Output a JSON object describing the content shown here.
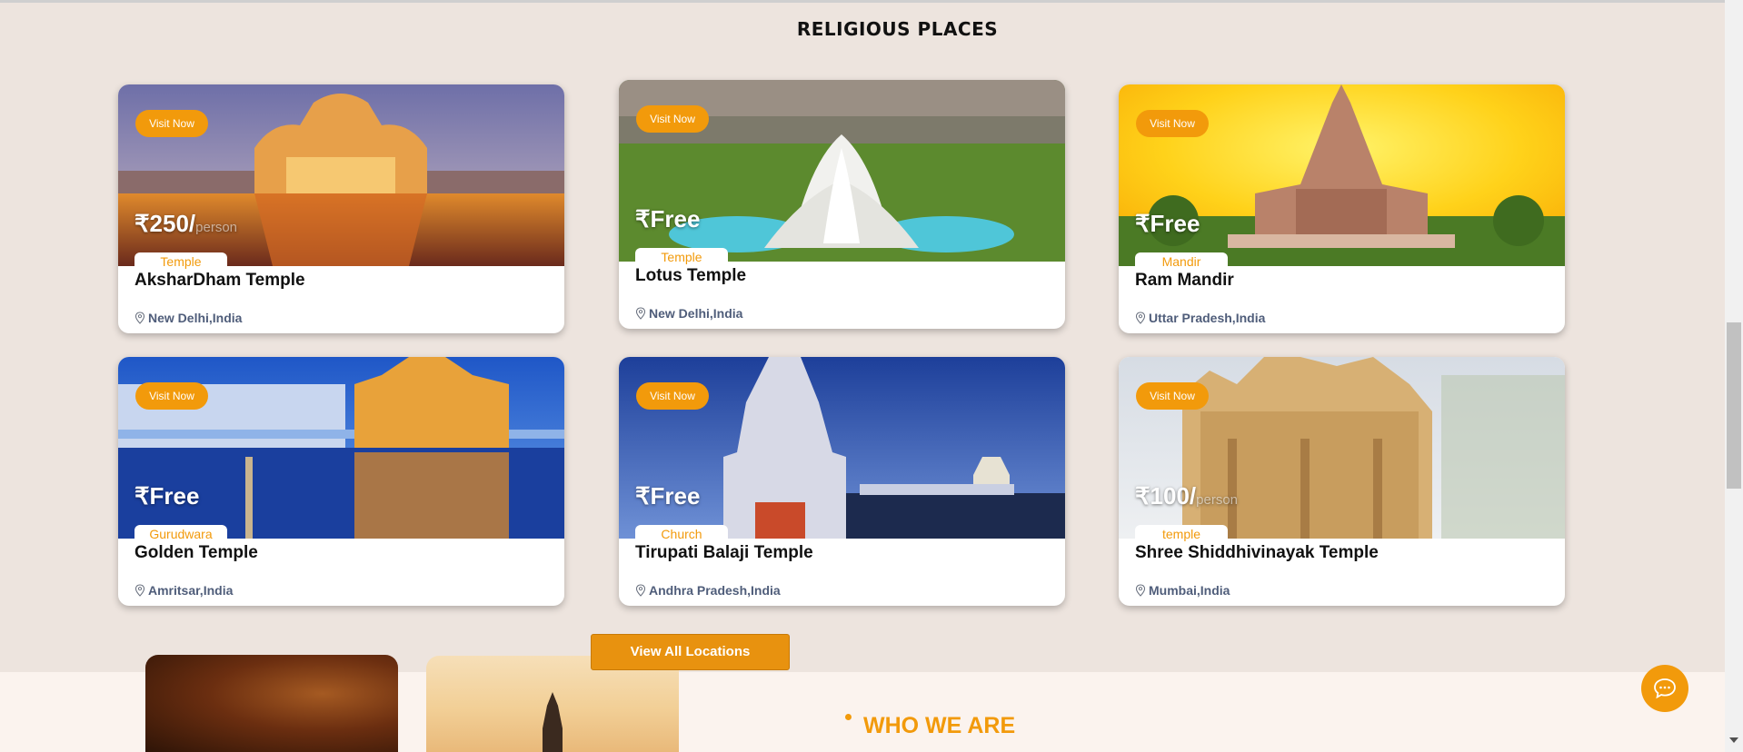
{
  "section": {
    "title": "RELIGIOUS PLACES"
  },
  "cards": [
    {
      "visit_label": "Visit Now",
      "currency": "₹",
      "price": "250/",
      "per": "person",
      "category": "Temple",
      "name": "AksharDham Temple",
      "location": "New Delhi,India"
    },
    {
      "visit_label": "Visit Now",
      "currency": "₹",
      "price": "Free",
      "per": "",
      "category": "Temple",
      "name": "Lotus Temple",
      "location": "New Delhi,India"
    },
    {
      "visit_label": "Visit Now",
      "currency": "₹",
      "price": "Free",
      "per": "",
      "category": "Mandir",
      "name": "Ram Mandir",
      "location": "Uttar Pradesh,India"
    },
    {
      "visit_label": "Visit Now",
      "currency": "₹",
      "price": "Free",
      "per": "",
      "category": "Gurudwara",
      "name": "Golden Temple",
      "location": "Amritsar,India"
    },
    {
      "visit_label": "Visit Now",
      "currency": "₹",
      "price": "Free",
      "per": "",
      "category": "Church",
      "name": "Tirupati Balaji Temple",
      "location": "Andhra Pradesh,India"
    },
    {
      "visit_label": "Visit Now",
      "currency": "₹",
      "price": "100/",
      "per": "person",
      "category": "temple",
      "name": "Shree Shiddhivinayak Temple",
      "location": "Mumbai,India"
    }
  ],
  "view_all_label": "View All Locations",
  "who_we_are": {
    "title": "WHO WE ARE"
  },
  "colors": {
    "accent": "#f29a0b",
    "background": "#ede4de",
    "location_text": "#4f5d7a"
  },
  "icons": {
    "location": "map-pin-icon",
    "chat": "chat-bubble-icon"
  }
}
